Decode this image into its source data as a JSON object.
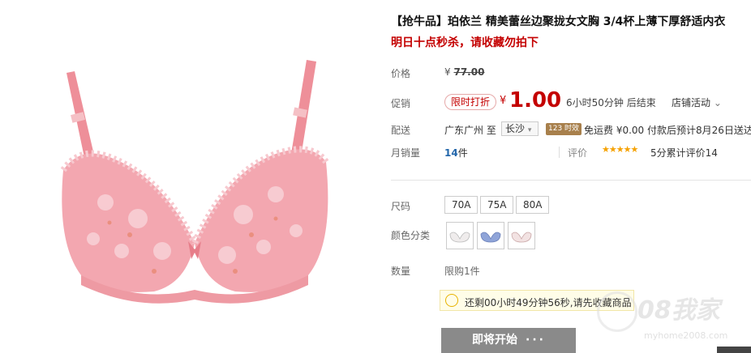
{
  "product": {
    "title": "【抢牛品】珀依兰 精美蕾丝边聚拢女文胸 3/4杯上薄下厚舒适内衣",
    "subtitle": "明日十点秒杀，请收藏勿拍下"
  },
  "price": {
    "label": "价格",
    "currency": "¥",
    "original": "77.00"
  },
  "promo": {
    "label": "促销",
    "tag": "限时打折",
    "currency": "¥",
    "price": "1.00",
    "countdown": "6小时50分钟 后结束",
    "store_activity": "店铺活动"
  },
  "shipping": {
    "label": "配送",
    "from": "广东广州 至",
    "city": "长沙",
    "hours_badge": "123 时效",
    "text": "免运费 ¥0.00 付款后预计8月26日送达"
  },
  "sales": {
    "label": "月销量",
    "count": "14",
    "unit": "件",
    "rating_label": "评价",
    "stars": "★★★★★",
    "rating_text": "5分累计评价14"
  },
  "size": {
    "label": "尺码",
    "options": [
      "70A",
      "75A",
      "80A"
    ]
  },
  "color": {
    "label": "颜色分类",
    "swatch_colors": [
      "#f0eeee",
      "#8fa4d8",
      "#f2e2e2"
    ]
  },
  "quantity": {
    "label": "数量",
    "limit": "限购1件"
  },
  "tip": {
    "text": "还剩00小时49分钟56秒,请先收藏商品"
  },
  "buy": {
    "label": "即将开始",
    "dots": "···"
  },
  "watermark": {
    "text": "08我家",
    "url": "myhome2008.com"
  },
  "colors": {
    "accent": "#c40000",
    "product_pink": "#f0a0a8",
    "button_gray": "#8a8a8a"
  }
}
